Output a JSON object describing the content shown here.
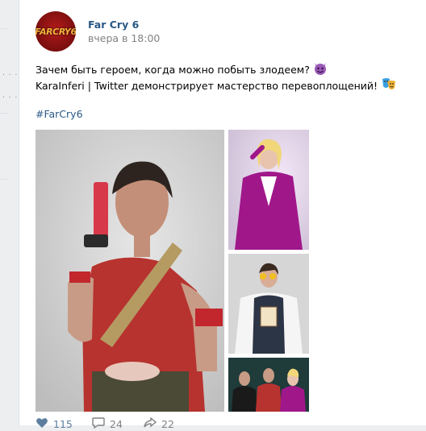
{
  "post": {
    "author": "Far Cry 6",
    "time": "вчера в 18:00",
    "avatar_text": "FARCRY6",
    "line1": "Зачем быть героем, когда можно побыть злодеем?",
    "line2": "KaraInferi | Twitter демонстрирует мастерство перевоплощений!",
    "hashtag": "#FarCry6"
  },
  "footer": {
    "likes": "115",
    "comments": "24",
    "shares": "22"
  },
  "icons": {
    "devil": "devil-emoji-icon",
    "masks": "theater-masks-emoji-icon",
    "like": "heart-icon",
    "comment": "comment-icon",
    "share": "share-icon"
  },
  "colors": {
    "link": "#2a5885",
    "muted": "#828282",
    "background": "#edeef0"
  }
}
